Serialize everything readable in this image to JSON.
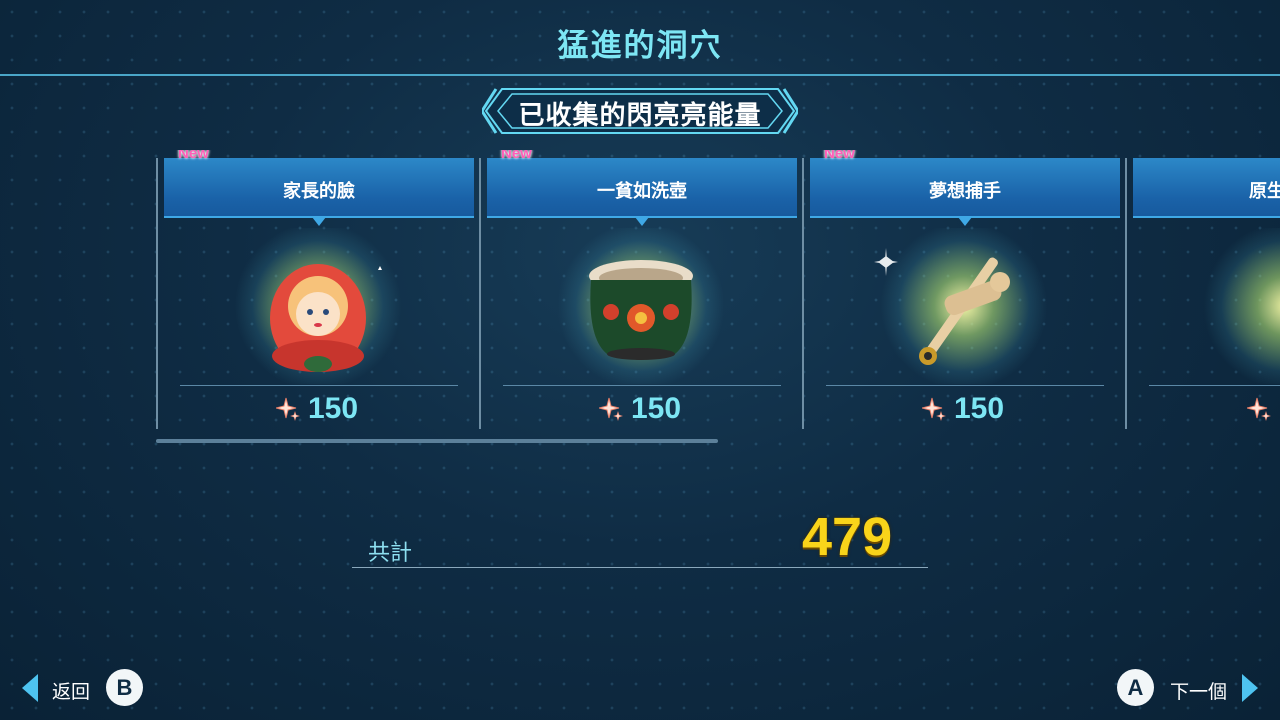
{
  "header": {
    "title": "猛進的洞穴"
  },
  "banner": {
    "label": "已收集的閃亮亮能量"
  },
  "items": [
    {
      "name": "家長的臉",
      "value": "150",
      "new_label": "New",
      "icon": "matryoshka-doll-icon"
    },
    {
      "name": "一貧如洗壺",
      "value": "150",
      "new_label": "New",
      "icon": "painted-pot-icon"
    },
    {
      "name": "夢想捕手",
      "value": "150",
      "new_label": "New",
      "icon": "kendama-icon"
    },
    {
      "name": "原生",
      "value": "",
      "new_label": "",
      "icon": "blue-blob-icon"
    }
  ],
  "scrollbar": {
    "visible_fraction": 0.5
  },
  "total": {
    "label": "共計",
    "value": "479"
  },
  "footer": {
    "back_label": "返回",
    "back_button": "B",
    "next_label": "下一個",
    "next_button": "A"
  },
  "colors": {
    "title": "#7de6f4",
    "value": "#7de6f4",
    "total": "#f9d41a",
    "new_badge": "#ff5fb8",
    "card_header": "#1a62a8"
  }
}
